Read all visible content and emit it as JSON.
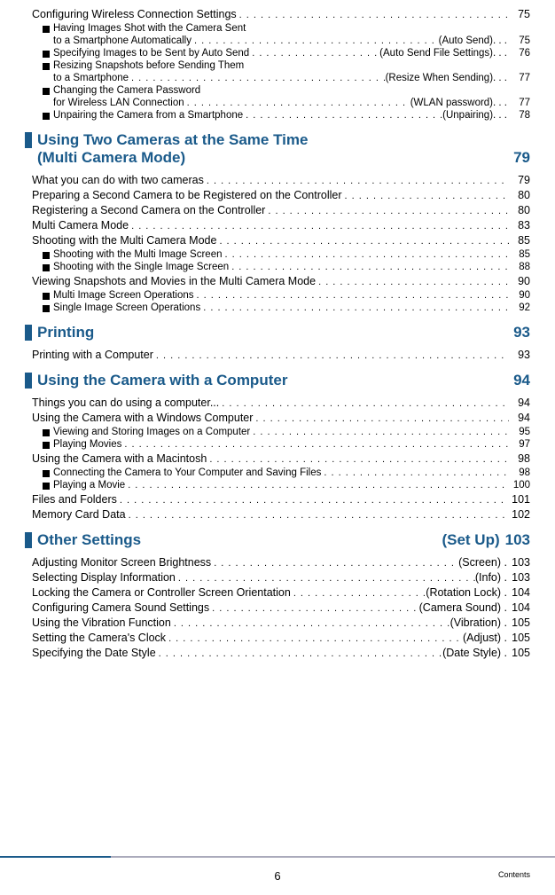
{
  "top": {
    "configuring": {
      "title": "Configuring Wireless Connection Settings",
      "page": "75"
    },
    "having1": {
      "title": "Having Images Shot with the Camera Sent"
    },
    "having2": {
      "title": "to a Smartphone Automatically",
      "suffix": "(Auto Send). . .",
      "page": "75"
    },
    "specifying": {
      "title": "Specifying Images to be Sent by Auto Send",
      "suffix": "(Auto Send File Settings). . .",
      "page": "76"
    },
    "resizing1": {
      "title": "Resizing Snapshots before Sending Them"
    },
    "resizing2": {
      "title": "to a Smartphone",
      "suffix": "(Resize When Sending). . .",
      "page": "77"
    },
    "changing1": {
      "title": "Changing the Camera Password"
    },
    "changing2": {
      "title": "for Wireless LAN Connection",
      "suffix": "(WLAN password). . .",
      "page": "77"
    },
    "unpairing": {
      "title": "Unpairing the Camera from a Smartphone",
      "suffix": "(Unpairing). . .",
      "page": "78"
    }
  },
  "sections": {
    "multicam": {
      "line1": "Using Two Cameras at the Same Time",
      "line2": "(Multi Camera Mode)",
      "page": "79"
    },
    "printing": {
      "title": "Printing",
      "page": "93"
    },
    "computer": {
      "title": "Using the Camera with a Computer",
      "page": "94"
    },
    "other": {
      "title": "Other Settings",
      "suffix": "(Set Up)",
      "page": "103"
    }
  },
  "multicam": {
    "what": {
      "title": "What you can do with two cameras",
      "page": "79"
    },
    "preparing": {
      "title": "Preparing a Second Camera to be Registered on the Controller",
      "page": "80"
    },
    "registering": {
      "title": "Registering a Second Camera on the Controller",
      "page": "80"
    },
    "mode": {
      "title": "Multi Camera Mode",
      "page": "83"
    },
    "shooting": {
      "title": "Shooting with the Multi Camera Mode",
      "page": "85"
    },
    "shootmulti": {
      "title": "Shooting with the Multi Image Screen",
      "page": "85"
    },
    "shootsingle": {
      "title": "Shooting with the Single Image Screen",
      "page": "88"
    },
    "viewing": {
      "title": "Viewing Snapshots and Movies in the Multi Camera Mode",
      "page": "90"
    },
    "multiops": {
      "title": "Multi Image Screen Operations",
      "page": "90"
    },
    "singleops": {
      "title": "Single Image Screen Operations",
      "page": "92"
    }
  },
  "printing": {
    "withcomp": {
      "title": "Printing with a Computer",
      "page": "93"
    }
  },
  "computer": {
    "things": {
      "title": "Things you can do using a computer...",
      "page": "94"
    },
    "windows": {
      "title": "Using the Camera with a Windows Computer",
      "page": "94"
    },
    "viewstore": {
      "title": "Viewing and Storing Images on a Computer",
      "page": "95"
    },
    "playmovies": {
      "title": "Playing Movies",
      "page": "97"
    },
    "mac": {
      "title": "Using the Camera with a Macintosh",
      "page": "98"
    },
    "connecting": {
      "title": "Connecting the Camera to Your Computer and Saving Files",
      "page": "98"
    },
    "playmovie": {
      "title": "Playing a Movie",
      "page": "100"
    },
    "files": {
      "title": "Files and Folders",
      "page": "101"
    },
    "memory": {
      "title": "Memory Card Data",
      "page": "102"
    }
  },
  "other": {
    "brightness": {
      "title": "Adjusting Monitor Screen Brightness",
      "suffix": "(Screen) .",
      "page": "103"
    },
    "display": {
      "title": "Selecting Display Information",
      "suffix": "(Info) .",
      "page": "103"
    },
    "locking": {
      "title": "Locking the Camera or Controller Screen Orientation",
      "suffix": "(Rotation Lock) .",
      "page": "104"
    },
    "sound": {
      "title": "Configuring Camera Sound Settings",
      "suffix": "(Camera Sound) .",
      "page": "104"
    },
    "vibration": {
      "title": "Using the Vibration Function",
      "suffix": "(Vibration) .",
      "page": "105"
    },
    "clock": {
      "title": "Setting the Camera's Clock",
      "suffix": "(Adjust) .",
      "page": "105"
    },
    "datestyle": {
      "title": "Specifying the Date Style",
      "suffix": "(Date Style) .",
      "page": "105"
    }
  },
  "footer": {
    "page": "6",
    "contents": "Contents"
  }
}
